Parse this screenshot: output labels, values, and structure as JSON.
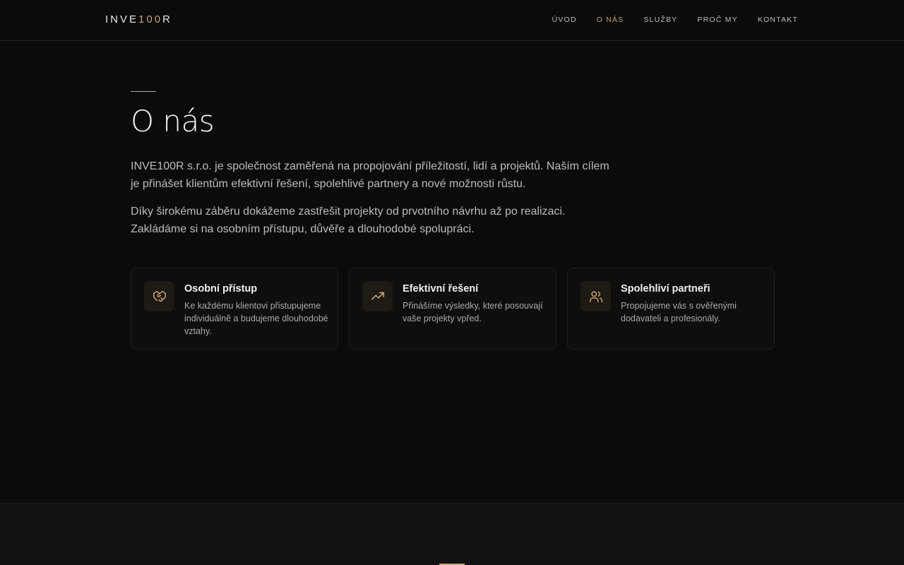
{
  "brand": {
    "logo_prefix": "INVE",
    "logo_accent": "100",
    "logo_suffix": "R",
    "accent_color": "#c9a468"
  },
  "nav": {
    "items": [
      {
        "label": "ÚVOD",
        "active": false
      },
      {
        "label": "O NÁS",
        "active": true
      },
      {
        "label": "SLUŽBY",
        "active": false
      },
      {
        "label": "PROČ MY",
        "active": false
      },
      {
        "label": "KONTAKT",
        "active": false
      }
    ]
  },
  "about": {
    "title": "O nás",
    "paragraphs": [
      "INVE100R s.r.o. je společnost zaměřená na propojování příležitostí, lidí a projektů. Naším cílem je přinášet klientům efektivní řešení, spolehlivé partnery a nové možnosti růstu.",
      "Díky širokému záběru dokážeme zastřešit projekty od prvotního návrhu až po realizaci. Zakládáme si na osobním přístupu, důvěře a dlouhodobé spolupráci."
    ],
    "cards": [
      {
        "icon": "handshake-icon",
        "title": "Osobní přístup",
        "text": "Ke každému klientovi přistupujeme individuálně a budujeme dlouhodobé vztahy."
      },
      {
        "icon": "trending-up-icon",
        "title": "Efektivní řešení",
        "text": "Přinášíme výsledky, které posouvají vaše projekty vpřed."
      },
      {
        "icon": "users-icon",
        "title": "Spolehliví partneři",
        "text": "Propojujeme vás s ověřenými dodavateli a profesionály."
      }
    ]
  }
}
